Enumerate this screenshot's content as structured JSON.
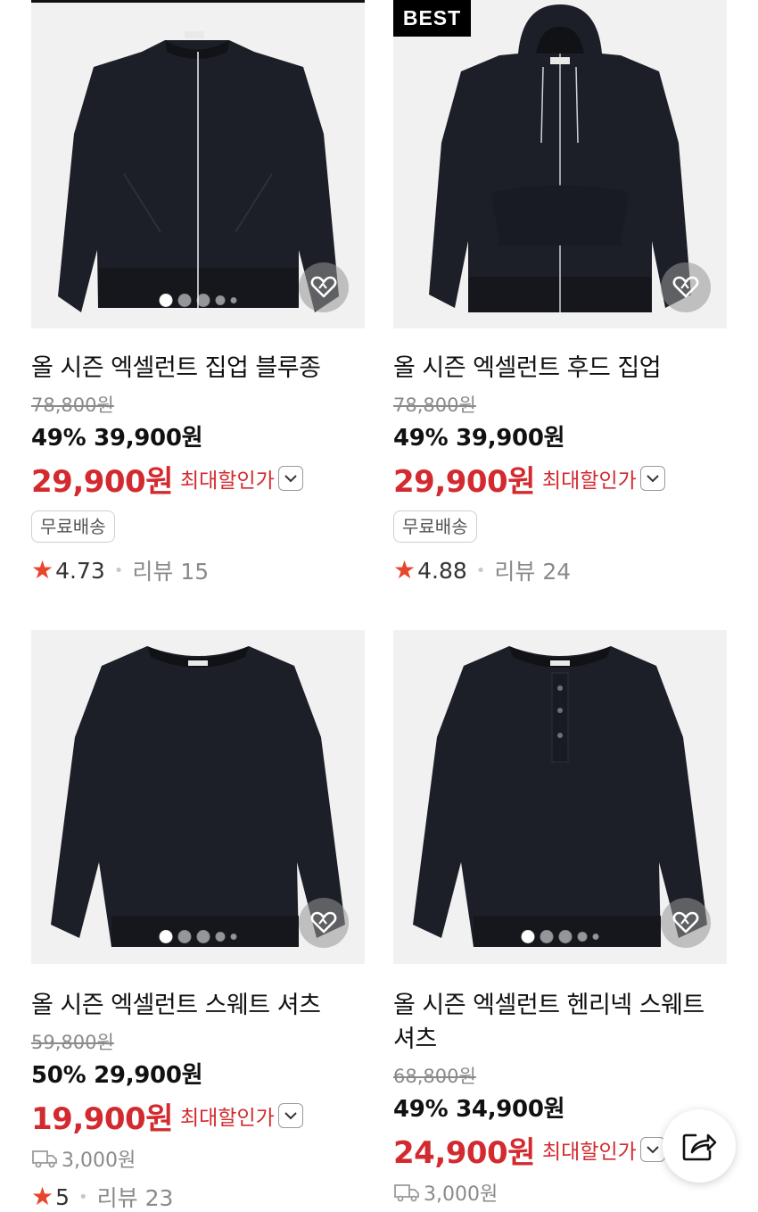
{
  "products": [
    {
      "badge": "",
      "title": "올 시즌 엑셀런트 집업 블루종",
      "original_price": "78,800원",
      "discount": "49%",
      "sale_price": "39,900원",
      "max_price": "29,900원",
      "max_label": "최대할인가",
      "tag": "무료배송",
      "shipping": "",
      "rating": "4.73",
      "review": "리뷰 15"
    },
    {
      "badge": "BEST",
      "title": "올 시즌 엑셀런트 후드 집업",
      "original_price": "78,800원",
      "discount": "49%",
      "sale_price": "39,900원",
      "max_price": "29,900원",
      "max_label": "최대할인가",
      "tag": "무료배송",
      "shipping": "",
      "rating": "4.88",
      "review": "리뷰 24"
    },
    {
      "badge": "",
      "title": "올 시즌 엑셀런트 스웨트 셔츠",
      "original_price": "59,800원",
      "discount": "50%",
      "sale_price": "29,900원",
      "max_price": "19,900원",
      "max_label": "최대할인가",
      "tag": "",
      "shipping": "3,000원",
      "rating": "5",
      "review": "리뷰 23"
    },
    {
      "badge": "",
      "title": "올 시즌 엑셀런트 헨리넥 스웨트 셔츠",
      "original_price": "68,800원",
      "discount": "49%",
      "sale_price": "34,900원",
      "max_price": "24,900원",
      "max_label": "최대할인가",
      "tag": "",
      "shipping": "3,000원",
      "rating": "",
      "review": ""
    }
  ],
  "icons": {
    "wishlist": "heart-icon",
    "share": "share-icon",
    "chevron": "chevron-down-icon",
    "delivery": "truck-icon",
    "star": "star-icon"
  },
  "colors": {
    "accent_red": "#d32a2f",
    "star_orange": "#e8452c",
    "garment": "#1c1f27"
  }
}
